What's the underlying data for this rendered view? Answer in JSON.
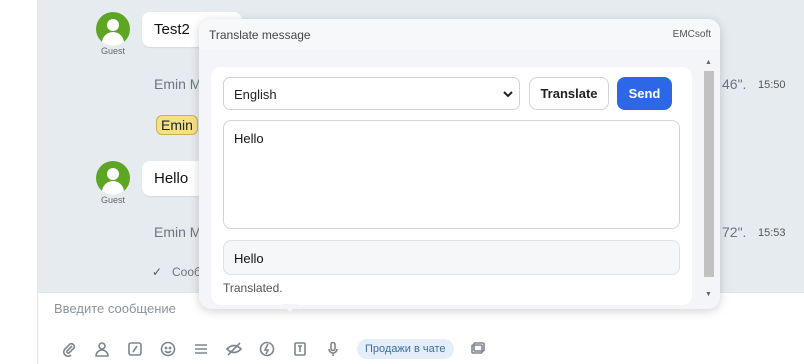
{
  "messages": [
    {
      "author_role": "Guest",
      "text": "Test2"
    },
    {
      "author_role": "Guest",
      "text": "Hello"
    }
  ],
  "system_lines": [
    {
      "text": "Emin M",
      "tail": "46\".",
      "time": "15:50"
    },
    {
      "text": "Emin M",
      "tail": "72\".",
      "time": "15:53"
    }
  ],
  "tag_label": "Emin",
  "delivered_text": "Сооб",
  "composer": {
    "placeholder": "Введите сообщение",
    "chip_label": "Продажи в чате"
  },
  "toolbar_icons": [
    "paperclip-icon",
    "contact-icon",
    "edit-icon",
    "emoji-icon",
    "template-icon",
    "hidden-eye-icon",
    "lightning-icon",
    "translate-icon",
    "microphone-icon",
    "chip",
    "layers-icon"
  ],
  "modal": {
    "title": "Translate message",
    "brand": "EMCsoft",
    "language": "English",
    "translate_label": "Translate",
    "send_label": "Send",
    "source_text": "Hello",
    "result_text": "Hello",
    "status": "Translated."
  },
  "colors": {
    "accent": "#2c67e8",
    "avatar": "#5fa524",
    "tag": "#f5e08a"
  }
}
